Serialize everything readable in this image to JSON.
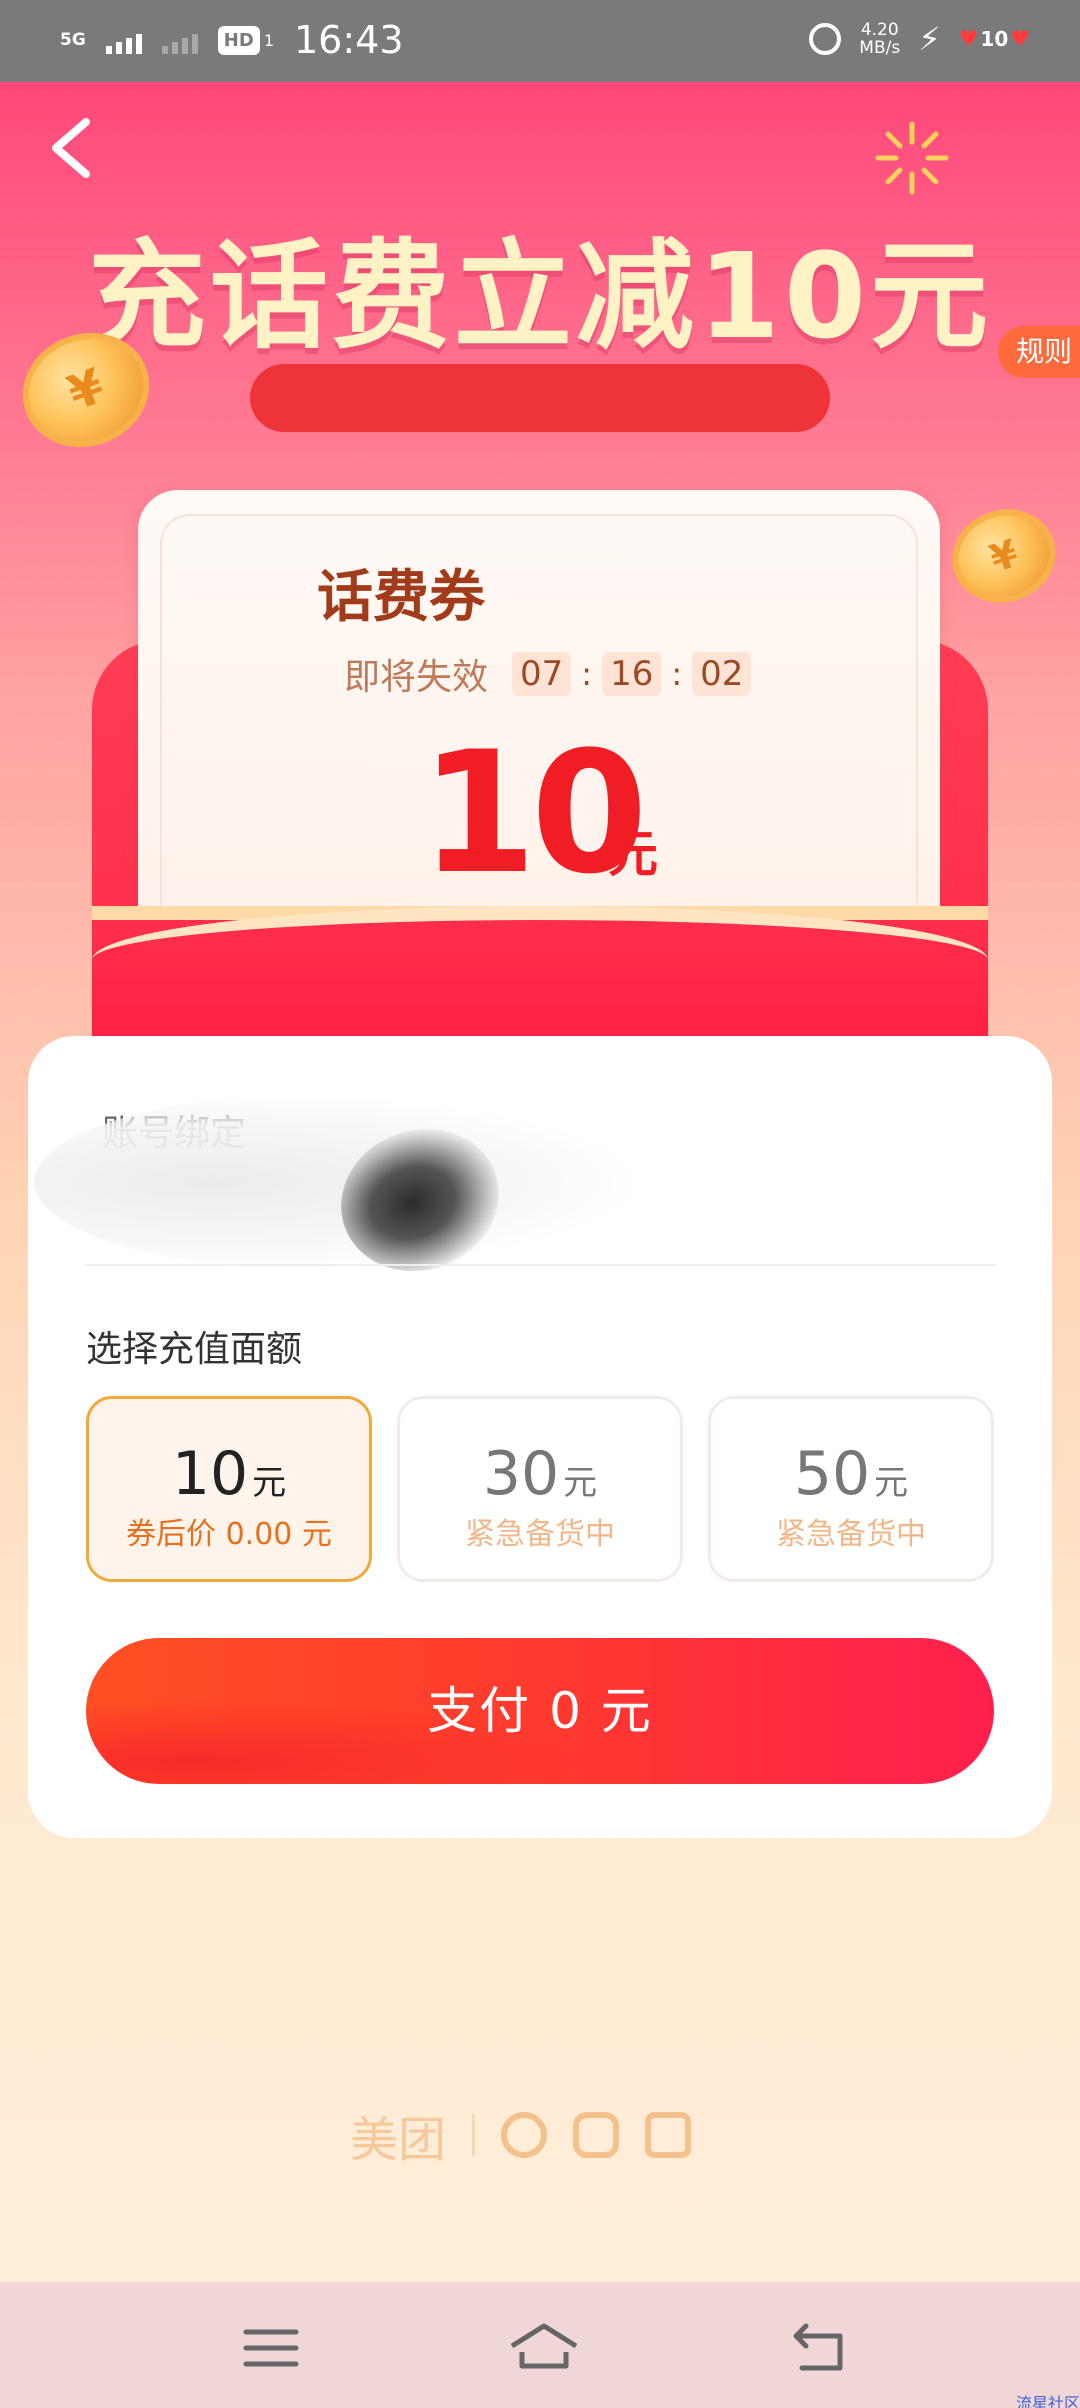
{
  "status_bar": {
    "network": "5G",
    "time": "16:43",
    "hd_label": "HD",
    "hd_sub": "1",
    "net_speed": "4.20",
    "net_speed_unit": "MB/s",
    "battery": "10"
  },
  "header": {
    "headline": "充话费立减10元",
    "rules_label": "规则"
  },
  "voucher": {
    "title": "话费券",
    "expire_label": "即将失效",
    "countdown": [
      "07",
      "16",
      "02"
    ],
    "amount": "10",
    "amount_unit": "元"
  },
  "panel": {
    "account_label": "账号绑定",
    "select_label": "选择充值面额",
    "options": [
      {
        "amount": "10",
        "unit": "元",
        "note": "券后价 0.00 元",
        "selected": true
      },
      {
        "amount": "30",
        "unit": "元",
        "note": "紧急备货中",
        "selected": false
      },
      {
        "amount": "50",
        "unit": "元",
        "note": "紧急备货中",
        "selected": false
      }
    ],
    "pay_label": "支付 0 元"
  },
  "partners": {
    "meituan": "美团"
  },
  "watermark": "流星社区",
  "colors": {
    "accent_red": "#f01d24",
    "pay_gradient_start": "#ff4f23",
    "pay_gradient_end": "#ff1f4e",
    "selected_border": "#f1a93b"
  }
}
